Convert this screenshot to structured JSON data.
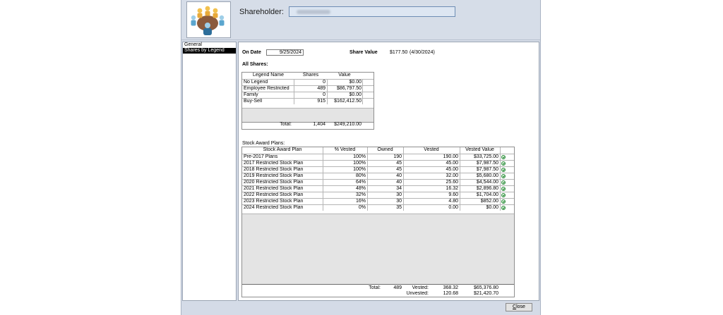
{
  "header": {
    "shareholder_label": "Shareholder:"
  },
  "nav": {
    "items": [
      {
        "label": "General"
      },
      {
        "label": "Shares by Legend"
      }
    ]
  },
  "main": {
    "on_date_label": "On Date",
    "on_date_value": "9/25/2024",
    "share_value_label": "Share Value",
    "share_value": "$177.50",
    "share_value_date": "(4/30/2024)",
    "all_shares_label": "All Shares:",
    "stock_award_plans_label": "Stock Award Plans:"
  },
  "shares_grid": {
    "headers": {
      "legend": "Legend Name",
      "shares": "Shares",
      "value": "Value"
    },
    "rows": [
      {
        "legend": "No Legend",
        "shares": "0",
        "value": "$0.00"
      },
      {
        "legend": "Employee Restricted",
        "shares": "489",
        "value": "$86,797.50"
      },
      {
        "legend": "Family",
        "shares": "0",
        "value": "$0.00"
      },
      {
        "legend": "Buy-Sell",
        "shares": "915",
        "value": "$162,412.50"
      }
    ],
    "total_label": "Total:",
    "total_shares": "1,404",
    "total_value": "$249,210.00"
  },
  "awards_grid": {
    "headers": {
      "plan": "Stock Award Plan",
      "pct": "% Vested",
      "owned": "Owned",
      "vested": "Vested",
      "vested_value": "Vested Value"
    },
    "rows": [
      {
        "plan": "Pre-2017 Plans",
        "pct": "100%",
        "owned": "190",
        "vested": "190.00",
        "value": "$33,725.00"
      },
      {
        "plan": "2017 Restricted Stock Plan",
        "pct": "100%",
        "owned": "45",
        "vested": "45.00",
        "value": "$7,987.50"
      },
      {
        "plan": "2018 Restricted Stock Plan",
        "pct": "100%",
        "owned": "45",
        "vested": "45.00",
        "value": "$7,987.50"
      },
      {
        "plan": "2019 Restricted Stock Plan",
        "pct": "80%",
        "owned": "40",
        "vested": "32.00",
        "value": "$5,680.00"
      },
      {
        "plan": "2020 Restricted Stock Plan",
        "pct": "64%",
        "owned": "40",
        "vested": "25.60",
        "value": "$4,544.00"
      },
      {
        "plan": "2021 Restricted Stock Plan",
        "pct": "48%",
        "owned": "34",
        "vested": "16.32",
        "value": "$2,896.80"
      },
      {
        "plan": "2022 Restricted Stock Plan",
        "pct": "32%",
        "owned": "30",
        "vested": "9.60",
        "value": "$1,704.00"
      },
      {
        "plan": "2023 Restricted Stock Plan",
        "pct": "16%",
        "owned": "30",
        "vested": "4.80",
        "value": "$852.00"
      },
      {
        "plan": "2024 Restricted Stock Plan",
        "pct": "0%",
        "owned": "35",
        "vested": "0.00",
        "value": "$0.00"
      }
    ],
    "total_label": "Total:",
    "total_owned": "489",
    "vested_label": "Vested:",
    "total_vested": "368.32",
    "total_vested_value": "$65,376.80",
    "unvested_label": "Unvested:",
    "total_unvested": "120.68",
    "total_unvested_value": "$21,420.70"
  },
  "footer": {
    "close_label_underlined": "C",
    "close_label_rest": "lose"
  }
}
